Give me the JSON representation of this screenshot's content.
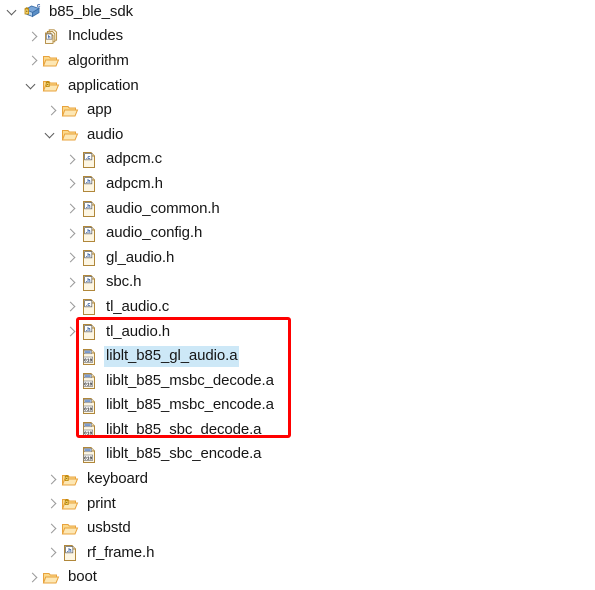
{
  "tree": {
    "name": "project-explorer-tree",
    "selected_item": "liblt_b85_gl_audio.a",
    "rows": [
      {
        "label": "b85_ble_sdk",
        "icon": "c-project-warning-icon",
        "indent": 0,
        "twisty": "open",
        "selected": false
      },
      {
        "label": "Includes",
        "icon": "includes-icon",
        "indent": 1,
        "twisty": "closed",
        "selected": false
      },
      {
        "label": "algorithm",
        "icon": "folder-icon",
        "indent": 1,
        "twisty": "closed",
        "selected": false
      },
      {
        "label": "application",
        "icon": "folder-warning-icon",
        "indent": 1,
        "twisty": "open",
        "selected": false
      },
      {
        "label": "app",
        "icon": "folder-icon",
        "indent": 2,
        "twisty": "closed",
        "selected": false
      },
      {
        "label": "audio",
        "icon": "folder-icon",
        "indent": 2,
        "twisty": "open",
        "selected": false
      },
      {
        "label": "adpcm.c",
        "icon": "c-file-icon",
        "indent": 3,
        "twisty": "closed",
        "selected": false
      },
      {
        "label": "adpcm.h",
        "icon": "h-file-icon",
        "indent": 3,
        "twisty": "closed",
        "selected": false
      },
      {
        "label": "audio_common.h",
        "icon": "h-file-icon",
        "indent": 3,
        "twisty": "closed",
        "selected": false
      },
      {
        "label": "audio_config.h",
        "icon": "h-file-icon",
        "indent": 3,
        "twisty": "closed",
        "selected": false
      },
      {
        "label": "gl_audio.h",
        "icon": "h-file-icon",
        "indent": 3,
        "twisty": "closed",
        "selected": false
      },
      {
        "label": "sbc.h",
        "icon": "h-file-icon",
        "indent": 3,
        "twisty": "closed",
        "selected": false
      },
      {
        "label": "tl_audio.c",
        "icon": "c-file-icon",
        "indent": 3,
        "twisty": "closed",
        "selected": false
      },
      {
        "label": "tl_audio.h",
        "icon": "h-file-icon",
        "indent": 3,
        "twisty": "closed",
        "selected": false
      },
      {
        "label": "liblt_b85_gl_audio.a",
        "icon": "archive-file-icon",
        "indent": 3,
        "twisty": "none",
        "selected": true
      },
      {
        "label": "liblt_b85_msbc_decode.a",
        "icon": "archive-file-icon",
        "indent": 3,
        "twisty": "none",
        "selected": false
      },
      {
        "label": "liblt_b85_msbc_encode.a",
        "icon": "archive-file-icon",
        "indent": 3,
        "twisty": "none",
        "selected": false
      },
      {
        "label": "liblt_b85_sbc_decode.a",
        "icon": "archive-file-icon",
        "indent": 3,
        "twisty": "none",
        "selected": false
      },
      {
        "label": "liblt_b85_sbc_encode.a",
        "icon": "archive-file-icon",
        "indent": 3,
        "twisty": "none",
        "selected": false
      },
      {
        "label": "keyboard",
        "icon": "folder-warning-icon",
        "indent": 2,
        "twisty": "closed",
        "selected": false
      },
      {
        "label": "print",
        "icon": "folder-warning-icon",
        "indent": 2,
        "twisty": "closed",
        "selected": false
      },
      {
        "label": "usbstd",
        "icon": "folder-icon",
        "indent": 2,
        "twisty": "closed",
        "selected": false
      },
      {
        "label": "rf_frame.h",
        "icon": "h-file-icon",
        "indent": 2,
        "twisty": "closed",
        "selected": false
      },
      {
        "label": "boot",
        "icon": "folder-icon",
        "indent": 1,
        "twisty": "closed",
        "selected": false
      }
    ]
  },
  "annotation": {
    "name": "red-highlight-box",
    "color": "#ff0000",
    "encloses": [
      "liblt_b85_gl_audio.a",
      "liblt_b85_msbc_decode.a",
      "liblt_b85_msbc_encode.a",
      "liblt_b85_sbc_decode.a",
      "liblt_b85_sbc_encode.a"
    ]
  },
  "colors": {
    "selection": "#cde8f7",
    "folder": "#e8a33d",
    "text": "#161616",
    "annotation": "#ff0000"
  }
}
